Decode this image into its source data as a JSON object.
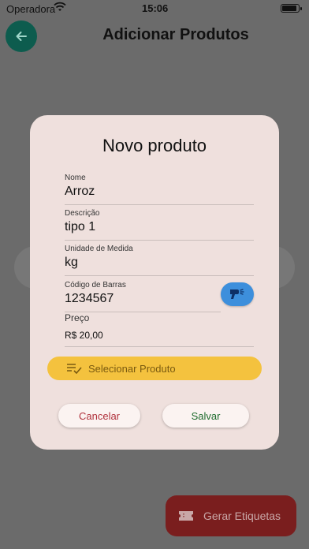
{
  "status_bar": {
    "carrier": "Operadora",
    "time": "15:06"
  },
  "app_bar": {
    "title": "Adicionar Produtos",
    "back_icon": "arrow-left-icon"
  },
  "dialog": {
    "title": "Novo produto",
    "fields": {
      "nome": {
        "label": "Nome",
        "value": "Arroz"
      },
      "descricao": {
        "label": "Descrição",
        "value": "tipo 1"
      },
      "unidade": {
        "label": "Unidade de Medida",
        "value": "kg"
      },
      "codigo": {
        "label": "Código de Barras",
        "value": "1234567"
      },
      "preco": {
        "label": "Preço",
        "value": "R$ 20,00"
      }
    },
    "scan_icon": "barcode-scanner-icon",
    "select_product_label": "Selecionar Produto",
    "select_icon": "checklist-icon",
    "cancel_label": "Cancelar",
    "save_label": "Salvar"
  },
  "fab": {
    "label": "Gerar Etiquetas",
    "icon": "ticket-icon"
  },
  "colors": {
    "accent_teal": "#0d5c4e",
    "dialog_bg": "#efe0dd",
    "select_button": "#f4c23e",
    "scan_button": "#3d8fdc",
    "cancel_text": "#b0313c",
    "save_text": "#1f6b2e",
    "fab_bg": "#7a1e1e"
  }
}
